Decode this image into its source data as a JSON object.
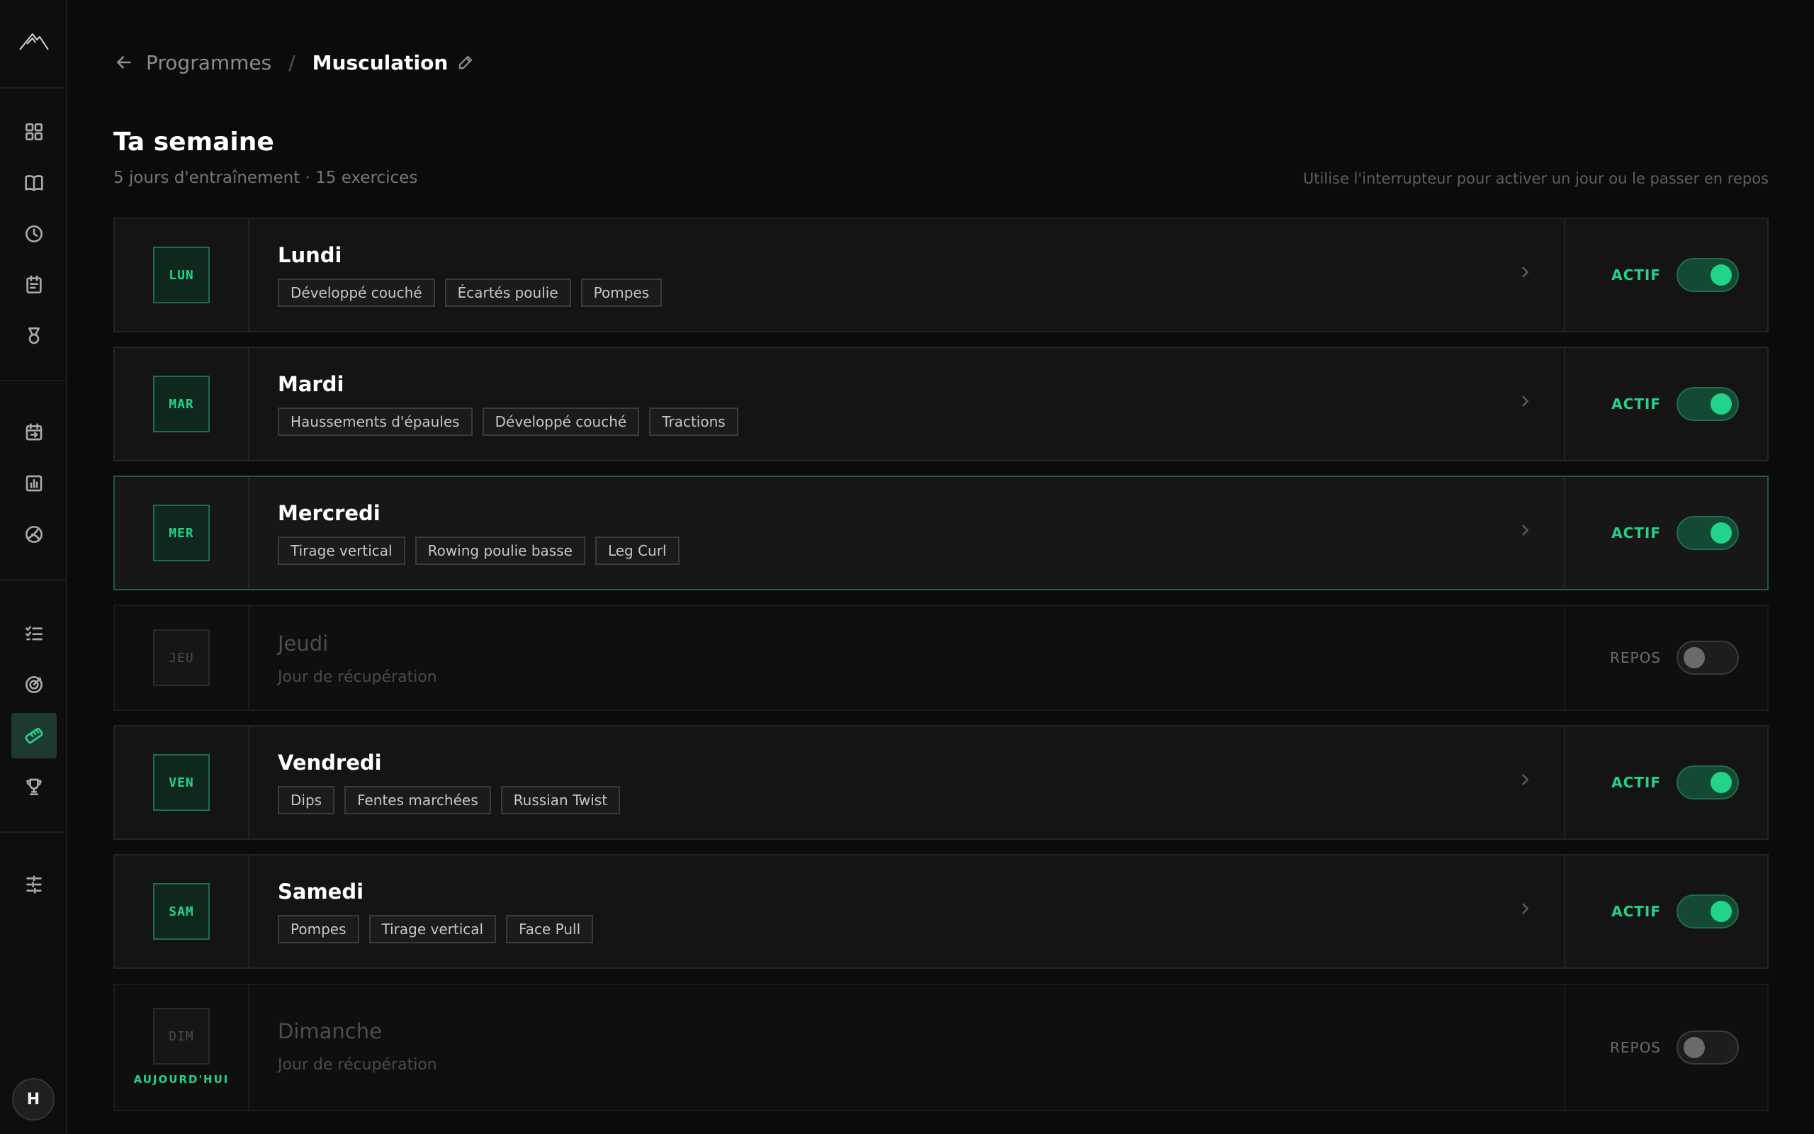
{
  "sidebar": {
    "avatar_initial": "H",
    "icons": [
      "logo-icon",
      "dashboard-icon",
      "library-icon",
      "history-icon",
      "calendar-icon",
      "medal-icon",
      "schedule-icon",
      "stats-icon",
      "nutrition-icon",
      "checklist-icon",
      "goals-icon",
      "programs-icon",
      "trophy-icon",
      "settings-icon"
    ],
    "active_item": "programs-icon"
  },
  "breadcrumb": {
    "parent": "Programmes",
    "separator": "/",
    "current": "Musculation"
  },
  "header": {
    "title": "Ta semaine",
    "subtitle": "5 jours d'entraînement · 15 exercices",
    "hint": "Utilise l'interrupteur pour activer un jour ou le passer en repos"
  },
  "days": [
    {
      "code": "LUN",
      "name": "Lundi",
      "status": "ACTIF",
      "exercises": [
        "Développé couché",
        "Écartés poulie",
        "Pompes"
      ]
    },
    {
      "code": "MAR",
      "name": "Mardi",
      "status": "ACTIF",
      "exercises": [
        "Haussements d'épaules",
        "Développé couché",
        "Tractions"
      ]
    },
    {
      "code": "MER",
      "name": "Mercredi",
      "status": "ACTIF",
      "exercises": [
        "Tirage vertical",
        "Rowing poulie basse",
        "Leg Curl"
      ]
    },
    {
      "code": "JEU",
      "name": "Jeudi",
      "status": "REPOS",
      "rest_text": "Jour de récupération"
    },
    {
      "code": "VEN",
      "name": "Vendredi",
      "status": "ACTIF",
      "exercises": [
        "Dips",
        "Fentes marchées",
        "Russian Twist"
      ]
    },
    {
      "code": "SAM",
      "name": "Samedi",
      "status": "ACTIF",
      "exercises": [
        "Pompes",
        "Tirage vertical",
        "Face Pull"
      ]
    },
    {
      "code": "DIM",
      "name": "Dimanche",
      "status": "REPOS",
      "rest_text": "Jour de récupération",
      "today_label": "AUJOURD'HUI"
    }
  ],
  "colors": {
    "accent": "#22d38a",
    "background": "#0b0b0b"
  }
}
